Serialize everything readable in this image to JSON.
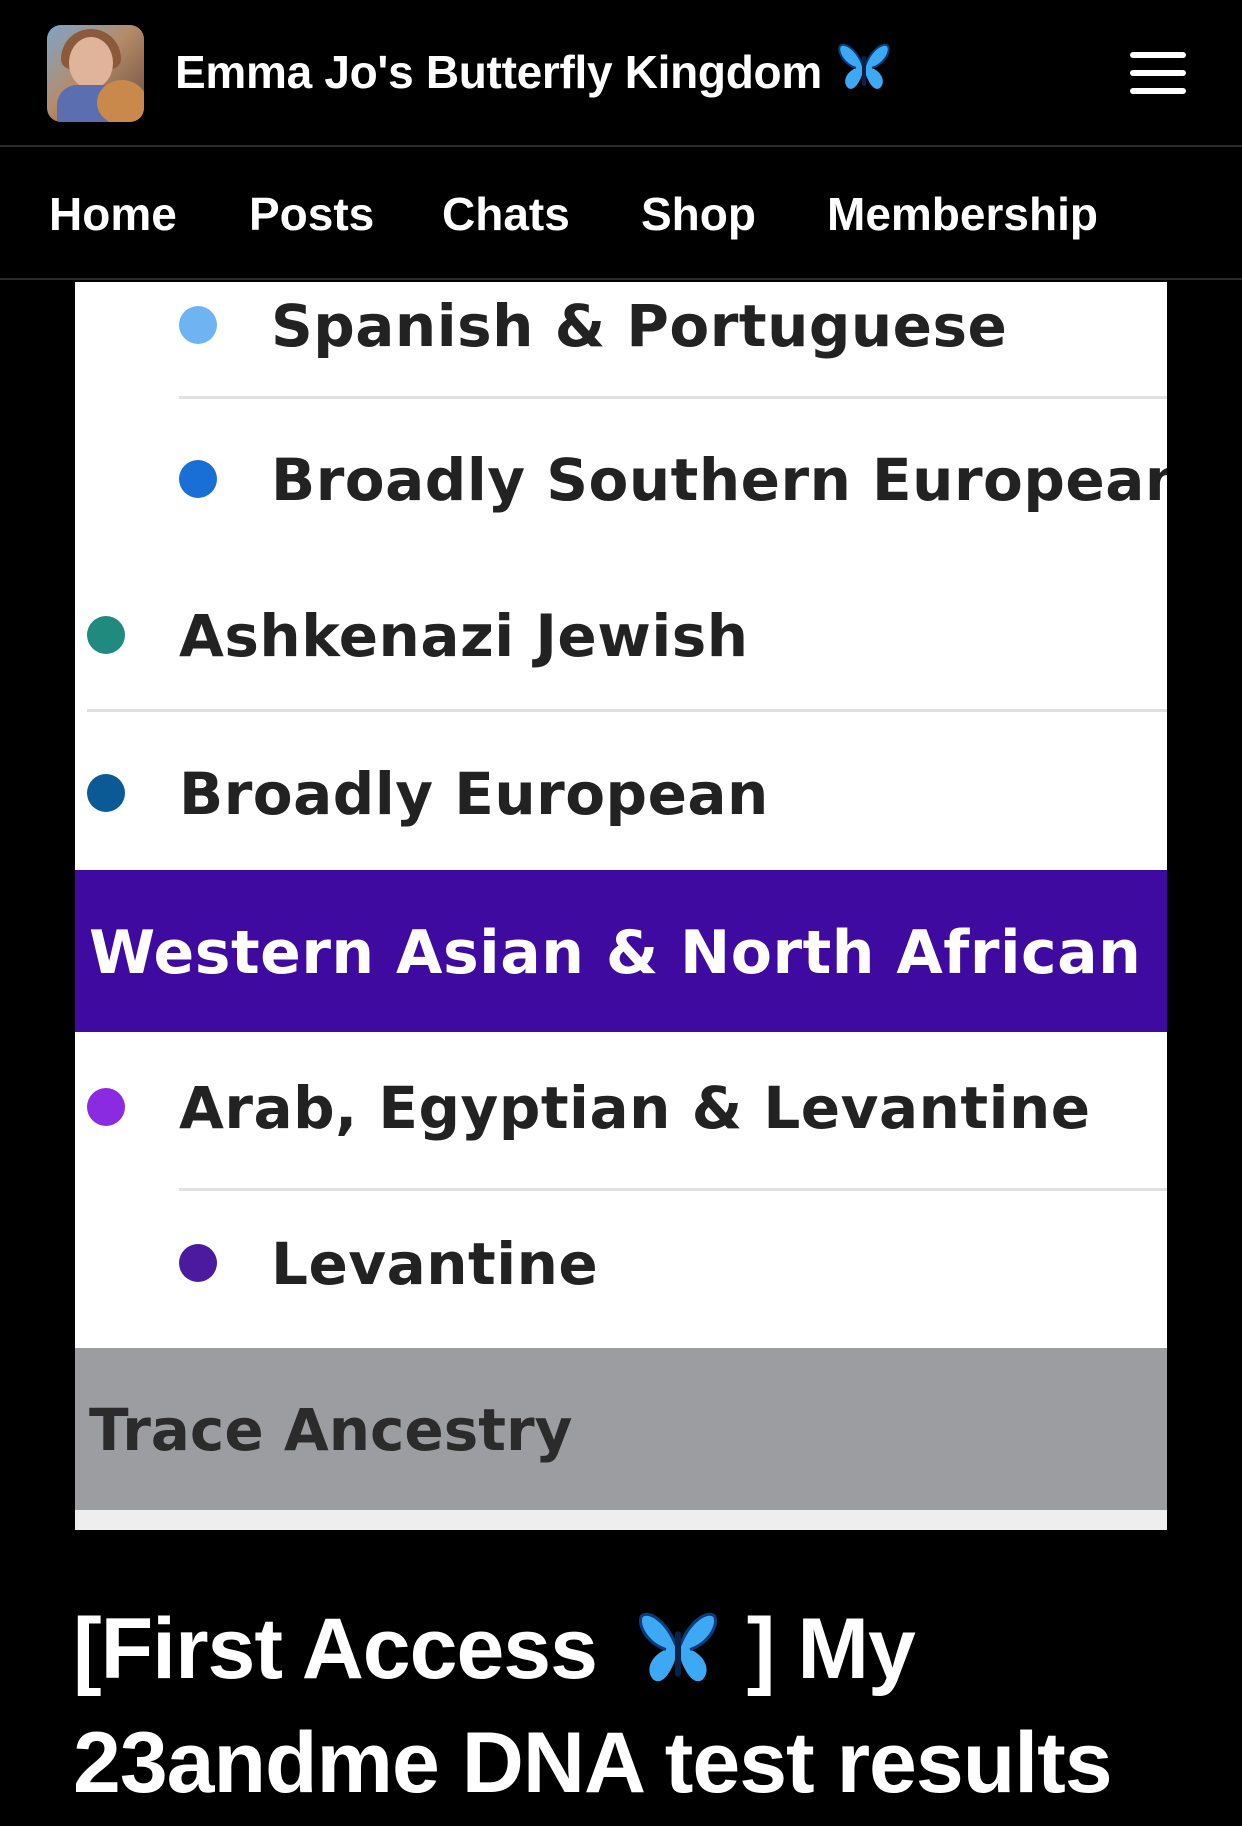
{
  "header": {
    "site_title": "Emma Jo's Butterfly Kingdom",
    "avatar_icon": "profile-avatar",
    "title_emoji_icon": "butterfly-icon",
    "menu_icon": "hamburger-menu-icon"
  },
  "nav": {
    "items": [
      {
        "label": "Home"
      },
      {
        "label": "Posts"
      },
      {
        "label": "Chats"
      },
      {
        "label": "Shop"
      },
      {
        "label": "Membership"
      }
    ]
  },
  "ancestry": {
    "rows": [
      {
        "label": "Spanish & Portuguese",
        "color": "#6fb4f2"
      },
      {
        "label": "Broadly Southern European",
        "color": "#1a6fd6"
      },
      {
        "label": "Ashkenazi Jewish",
        "color": "#1f8a7d"
      },
      {
        "label": "Broadly European",
        "color": "#0b5a96"
      }
    ],
    "region_header": {
      "label": "Western Asian & North African",
      "color": "#3f0aa0"
    },
    "region_rows": [
      {
        "label": "Arab, Egyptian & Levantine",
        "color": "#8a2be2"
      },
      {
        "label": "Levantine",
        "color": "#4b1a9e"
      }
    ],
    "trace_button": {
      "label": "Trace Ancestry"
    }
  },
  "post": {
    "title_line1_before": "[First Access",
    "title_line1_after": "] My",
    "title_line2": "23andme DNA test results",
    "title_emoji_icon": "butterfly-icon"
  },
  "colors": {
    "background": "#000000",
    "region_header": "#3f0aa0",
    "trace_bar": "#9c9da0",
    "butterfly_blue": "#3da9f5"
  }
}
